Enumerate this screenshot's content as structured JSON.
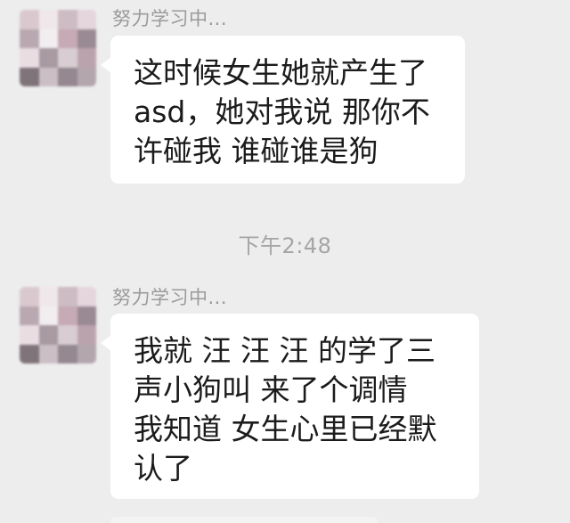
{
  "chat": {
    "messages": [
      {
        "sender": "努力学习中...",
        "text": "这时候女生她就产生了\nasd，她对我说  那你不\n许碰我  谁碰谁是狗"
      },
      {
        "sender": "努力学习中...",
        "text": "我就  汪  汪  汪  的学了三\n声小狗叫  来了个调情\n我知道  女生心里已经默\n认了"
      }
    ],
    "timestamp": "下午2:48"
  },
  "colors": {
    "background": "#ededed",
    "bubble": "#ffffff",
    "text": "#1b1b1b",
    "sender": "#9a9a9a",
    "timestamp": "#a5a5a5"
  }
}
